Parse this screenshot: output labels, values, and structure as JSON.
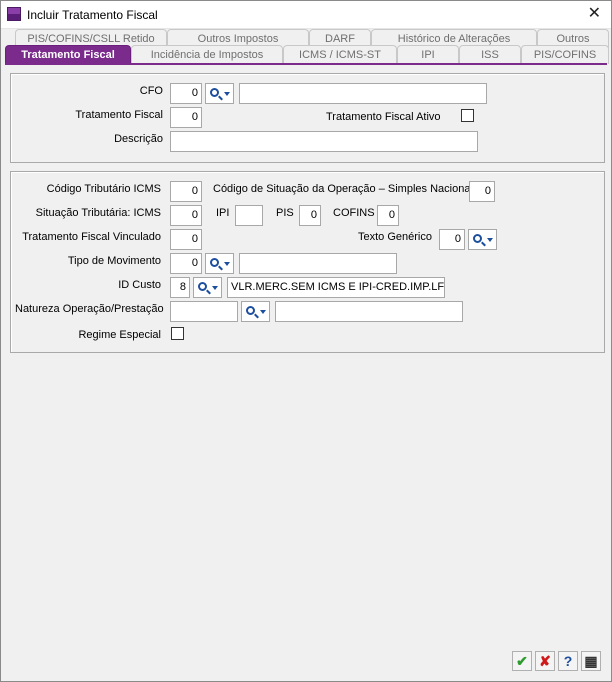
{
  "window": {
    "title": "Incluir Tratamento Fiscal"
  },
  "tabs_back": [
    "PIS/COFINS/CSLL Retido",
    "Outros Impostos",
    "DARF",
    "Histórico de Alterações",
    "Outros"
  ],
  "tabs_front": [
    "Tratamento Fiscal",
    "Incidência de Impostos",
    "ICMS / ICMS-ST",
    "IPI",
    "ISS",
    "PIS/COFINS"
  ],
  "section1": {
    "cfo_label": "CFO",
    "cfo_value": "0",
    "cfo_desc": "",
    "tratamento_label": "Tratamento Fiscal",
    "tratamento_value": "0",
    "ativo_label": "Tratamento Fiscal Ativo",
    "descricao_label": "Descrição",
    "descricao_value": ""
  },
  "section2": {
    "cod_trib_icms_label": "Código Tributário ICMS",
    "cod_trib_icms_value": "0",
    "csosn_label": "Código de Situação da Operação – Simples Nacional",
    "csosn_value": "0",
    "sit_trib_label": "Situação Tributária: ICMS",
    "sit_trib_icms_value": "0",
    "ipi_label": "IPI",
    "ipi_value": "",
    "pis_label": "PIS",
    "pis_value": "0",
    "cofins_label": "COFINS",
    "cofins_value": "0",
    "trat_vinc_label": "Tratamento Fiscal Vinculado",
    "trat_vinc_value": "0",
    "texto_gen_label": "Texto Genérico",
    "texto_gen_value": "0",
    "tipo_mov_label": "Tipo de Movimento",
    "tipo_mov_value": "0",
    "tipo_mov_desc": "",
    "id_custo_label": "ID Custo",
    "id_custo_value": "8",
    "id_custo_desc": "VLR.MERC.SEM ICMS E IPI-CRED.IMP.LF",
    "natureza_label": "Natureza Operação/Prestação",
    "natureza_value": "",
    "natureza_desc": "",
    "regime_label": "Regime Especial"
  },
  "footer": {
    "ok_icon": "✔",
    "cancel_icon": "✘",
    "help_icon": "?",
    "calc_icon": "▦"
  },
  "colors": {
    "accent": "#7a2b8c",
    "ok": "#2e9b2e",
    "cancel": "#d01818",
    "help": "#1d4e9e"
  }
}
